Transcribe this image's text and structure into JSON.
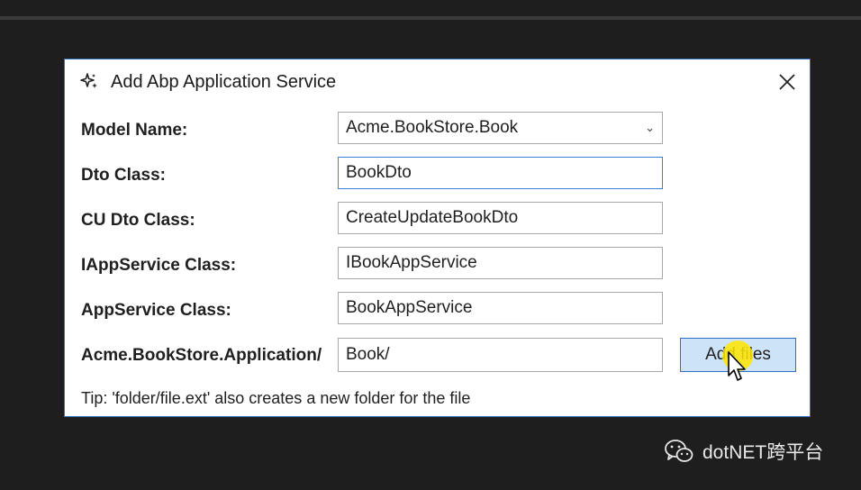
{
  "dialog": {
    "title": "Add Abp Application Service",
    "close_glyph": "✕",
    "fields": [
      {
        "label": "Model Name:",
        "value": "Acme.BookStore.Book",
        "type": "select"
      },
      {
        "label": "Dto Class:",
        "value": "BookDto",
        "type": "text",
        "focused": true
      },
      {
        "label": "CU Dto Class:",
        "value": "CreateUpdateBookDto",
        "type": "text"
      },
      {
        "label": "IAppService Class:",
        "value": "IBookAppService",
        "type": "text"
      },
      {
        "label": "AppService Class:",
        "value": "BookAppService",
        "type": "text"
      },
      {
        "label": "Acme.BookStore.Application/",
        "value": "Book/",
        "type": "text"
      }
    ],
    "add_button_label": "Add files",
    "tip": "Tip: 'folder/file.ext' also creates a new folder for the file"
  },
  "watermark": {
    "text": "dotNET跨平台"
  },
  "colors": {
    "accent": "#2f6fbf",
    "button_bg": "#cde3f7",
    "background": "#1e1e1e"
  }
}
